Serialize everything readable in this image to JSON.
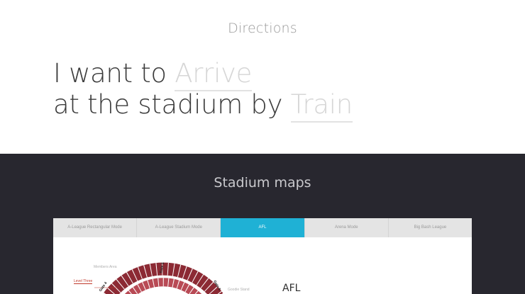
{
  "directions": {
    "title": "Directions",
    "line1_prefix": "I want to ",
    "mode_value": "Arrive",
    "line2_prefix": "at the stadium by ",
    "transport_value": "Train"
  },
  "stadium_maps": {
    "title": "Stadium maps",
    "tabs": [
      {
        "label": "A-League Rectangular Mode",
        "active": false
      },
      {
        "label": "A-League Stadium Mode",
        "active": false
      },
      {
        "label": "AFL",
        "active": true
      },
      {
        "label": "Arena Mode",
        "active": false
      },
      {
        "label": "Big Bash League",
        "active": false
      }
    ],
    "map": {
      "heading": "AFL",
      "labels": {
        "members": "Members Area",
        "level": "Level Three",
        "stand": "Goodie Stand"
      },
      "gates": [
        "Gate 5",
        "Gate 4",
        "Gate 6"
      ]
    }
  },
  "colors": {
    "dark_background": "#28272f",
    "active_tab": "#1fb1d5",
    "seat_dark": "#8c2a34",
    "seat_light": "#b84a55"
  }
}
